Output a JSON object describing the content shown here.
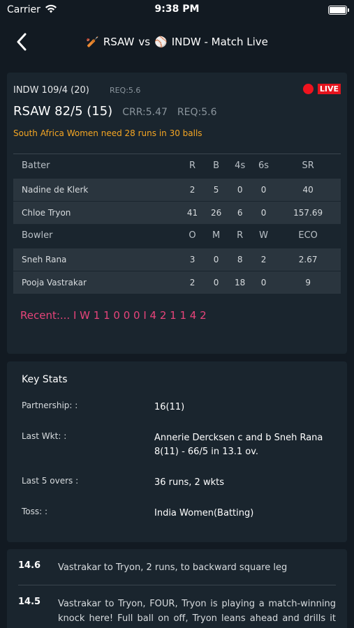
{
  "status": {
    "carrier": "Carrier",
    "time": "9:38 PM"
  },
  "nav": {
    "title": "RSAW vs 🏏 INDW - Match Live",
    "team1": "RSAW",
    "vs": "vs",
    "team2": "INDW - Match Live"
  },
  "score": {
    "team1_score": "INDW 109/4 (20)",
    "team1_req": "REQ:5.6",
    "live": "LIVE",
    "team2_score": "RSAW 82/5 (15)",
    "crr": "CRR:5.47",
    "req": "REQ:5.6",
    "need": "South Africa Women need 28 runs in 30 balls"
  },
  "batting": {
    "headers": [
      "Batter",
      "R",
      "B",
      "4s",
      "6s",
      "SR"
    ],
    "rows": [
      [
        "Nadine de Klerk",
        "2",
        "5",
        "0",
        "0",
        "40"
      ],
      [
        "Chloe Tryon",
        "41",
        "26",
        "6",
        "0",
        "157.69"
      ]
    ]
  },
  "bowling": {
    "headers": [
      "Bowler",
      "O",
      "M",
      "R",
      "W",
      "ECO"
    ],
    "rows": [
      [
        "Sneh Rana",
        "3",
        "0",
        "8",
        "2",
        "2.67"
      ],
      [
        "Pooja Vastrakar",
        "2",
        "0",
        "18",
        "0",
        "9"
      ]
    ]
  },
  "recent": "Recent:... I W 1 1 0 0 0 I 4 2 1 1 4 2",
  "key_stats": {
    "title": "Key Stats",
    "rows": [
      {
        "label": "Partnership:  :",
        "value": "16(11)"
      },
      {
        "label": "Last Wkt:  :",
        "value": "Annerie Dercksen c and b Sneh Rana 8(11) - 66/5 in 13.1 ov."
      },
      {
        "label": "Last 5 overs  :",
        "value": "36 runs, 2 wkts"
      },
      {
        "label": "Toss:  :",
        "value": "India Women(Batting)"
      }
    ]
  },
  "commentary": [
    {
      "over": "14.6",
      "text": "Vastrakar to Tryon, 2 runs, to backward square leg"
    },
    {
      "over": "14.5",
      "text": "Vastrakar to Tryon, FOUR, Tryon is playing a match-winning knock here! Full ball on off, Tryon leans ahead and drills it past the bowler, no chance."
    }
  ]
}
